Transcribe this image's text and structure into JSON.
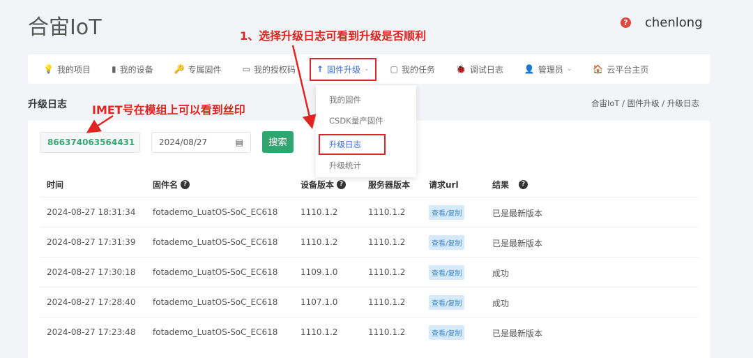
{
  "header": {
    "title": "合宙IoT",
    "help_icon": "?",
    "user": "chenlong"
  },
  "nav": [
    {
      "icon": "💡",
      "label": "我的项目"
    },
    {
      "icon": "▮",
      "label": "我的设备"
    },
    {
      "icon": "🔑",
      "label": "专属固件"
    },
    {
      "icon": "▭",
      "label": "我的授权码"
    },
    {
      "icon": "↑",
      "label": "固件升级",
      "dropdown": true,
      "active": true
    },
    {
      "icon": "▢",
      "label": "我的任务"
    },
    {
      "icon": "🐞",
      "label": "调试日志"
    },
    {
      "icon": "👤",
      "label": "管理员",
      "dropdown": true
    },
    {
      "icon": "🏠",
      "label": "云平台主页"
    }
  ],
  "dropdown": [
    "我的固件",
    "CSDK量产固件",
    "升级日志",
    "升级统计"
  ],
  "page": {
    "title": "升级日志",
    "breadcrumb": "合宙IoT  /  固件升级  /  升级日志"
  },
  "filters": {
    "imei": "866374063564431",
    "date": "2024/08/27",
    "search": "搜索"
  },
  "table": {
    "headers": [
      "时间",
      "固件名",
      "设备版本",
      "服务器版本",
      "请求url",
      "结果"
    ],
    "rows": [
      [
        "2024-08-27 18:31:34",
        "fotademo_LuatOS-SoC_EC618",
        "1110.1.2",
        "1110.1.2",
        "查看/复制",
        "已是最新版本"
      ],
      [
        "2024-08-27 17:31:39",
        "fotademo_LuatOS-SoC_EC618",
        "1110.1.2",
        "1110.1.2",
        "查看/复制",
        "已是最新版本"
      ],
      [
        "2024-08-27 17:30:18",
        "fotademo_LuatOS-SoC_EC618",
        "1109.1.0",
        "1110.1.2",
        "查看/复制",
        "成功"
      ],
      [
        "2024-08-27 17:28:40",
        "fotademo_LuatOS-SoC_EC618",
        "1107.1.0",
        "1110.1.2",
        "查看/复制",
        "成功"
      ],
      [
        "2024-08-27 17:23:48",
        "fotademo_LuatOS-SoC_EC618",
        "1110.1.2",
        "1110.1.2",
        "查看/复制",
        "已是最新版本"
      ]
    ]
  },
  "annotations": {
    "top": "1、选择升级日志可看到升级是否顺利",
    "imei": "IMET号在模组上可以看到丝印"
  }
}
